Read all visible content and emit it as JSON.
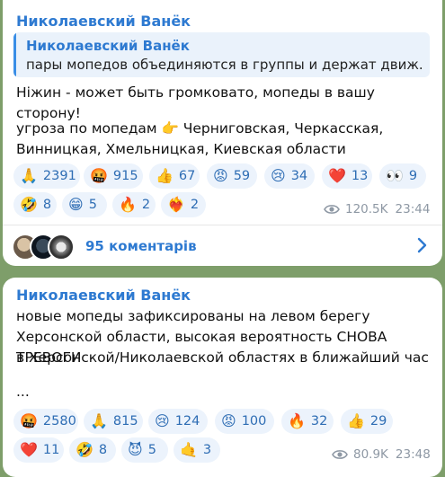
{
  "post1": {
    "author": "Николаевский Ванёк",
    "reply": {
      "author": "Николаевский Ванёк",
      "text": "пары мопедов объединяются в группы и держат движ..."
    },
    "text_line1": "Ніжин - может быть громковато, мопеды в вашу сторону!",
    "text_line2": "угроза по мопедам 👉 Черниговская, Черкасская,",
    "text_line3": "Винницкая, Хмельницкая, Киевская области",
    "reactions": [
      {
        "emoji": "🙏",
        "count": "2391"
      },
      {
        "emoji": "🤬",
        "count": "915"
      },
      {
        "emoji": "👍",
        "count": "67"
      },
      {
        "emoji": "😡",
        "count": "59"
      },
      {
        "emoji": "😢",
        "count": "34"
      },
      {
        "emoji": "❤️",
        "count": "13"
      },
      {
        "emoji": "👀",
        "count": "9"
      },
      {
        "emoji": "🤣",
        "count": "8"
      },
      {
        "emoji": "😁",
        "count": "5"
      },
      {
        "emoji": "🔥",
        "count": "2"
      },
      {
        "emoji": "❤️‍🔥",
        "count": "2"
      }
    ],
    "views": "120.5K",
    "time": "23:44",
    "comments_label": "95 коментарів"
  },
  "post2": {
    "author": "Николаевский Ванёк",
    "text_line1": "новые мопеды зафиксированы на левом берегу",
    "text_line2": "Херсонской области, высокая вероятность СНОВА ТРЕВОГИ",
    "text_line3": "в Херсонской/Николаевской областях в ближайший час",
    "text_line4": "...",
    "reactions": [
      {
        "emoji": "🤬",
        "count": "2580"
      },
      {
        "emoji": "🙏",
        "count": "815"
      },
      {
        "emoji": "😢",
        "count": "124"
      },
      {
        "emoji": "😡",
        "count": "100"
      },
      {
        "emoji": "🔥",
        "count": "32"
      },
      {
        "emoji": "👍",
        "count": "29"
      },
      {
        "emoji": "❤️",
        "count": "11"
      },
      {
        "emoji": "🤣",
        "count": "8"
      },
      {
        "emoji": "😈",
        "count": "5"
      },
      {
        "emoji": "🤙",
        "count": "3"
      }
    ],
    "views": "80.9K",
    "time": "23:48"
  },
  "icons": {
    "views": "eye-icon",
    "comments_arrow": "chevron-right-icon"
  },
  "colors": {
    "accent": "#2e7ad1",
    "background": "#7e9e6a",
    "pill": "#ecf3fc"
  }
}
